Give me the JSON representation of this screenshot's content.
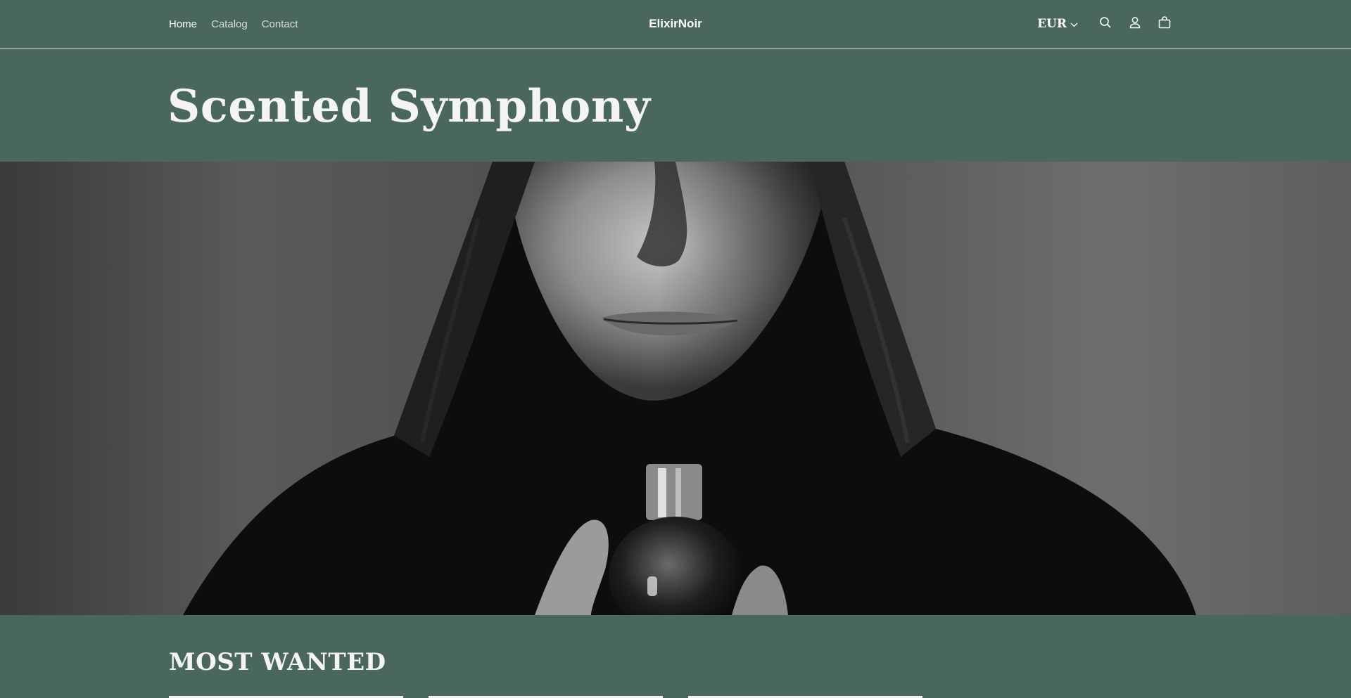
{
  "nav": {
    "items": [
      {
        "label": "Home",
        "active": true
      },
      {
        "label": "Catalog",
        "active": false
      },
      {
        "label": "Contact",
        "active": false
      }
    ]
  },
  "brand": {
    "name": "ElixirNoir"
  },
  "header": {
    "currency": "EUR",
    "icons": [
      "search-icon",
      "account-icon",
      "cart-icon"
    ]
  },
  "hero": {
    "title": "Scented Symphony",
    "image_alt": "Black and white portrait of a man in a dark coat holding a perfume bottle"
  },
  "featured": {
    "title": "MOST WANTED"
  },
  "colors": {
    "background": "#4a675e",
    "text": "#ffffff",
    "nav_muted": "#d2ddd8"
  }
}
